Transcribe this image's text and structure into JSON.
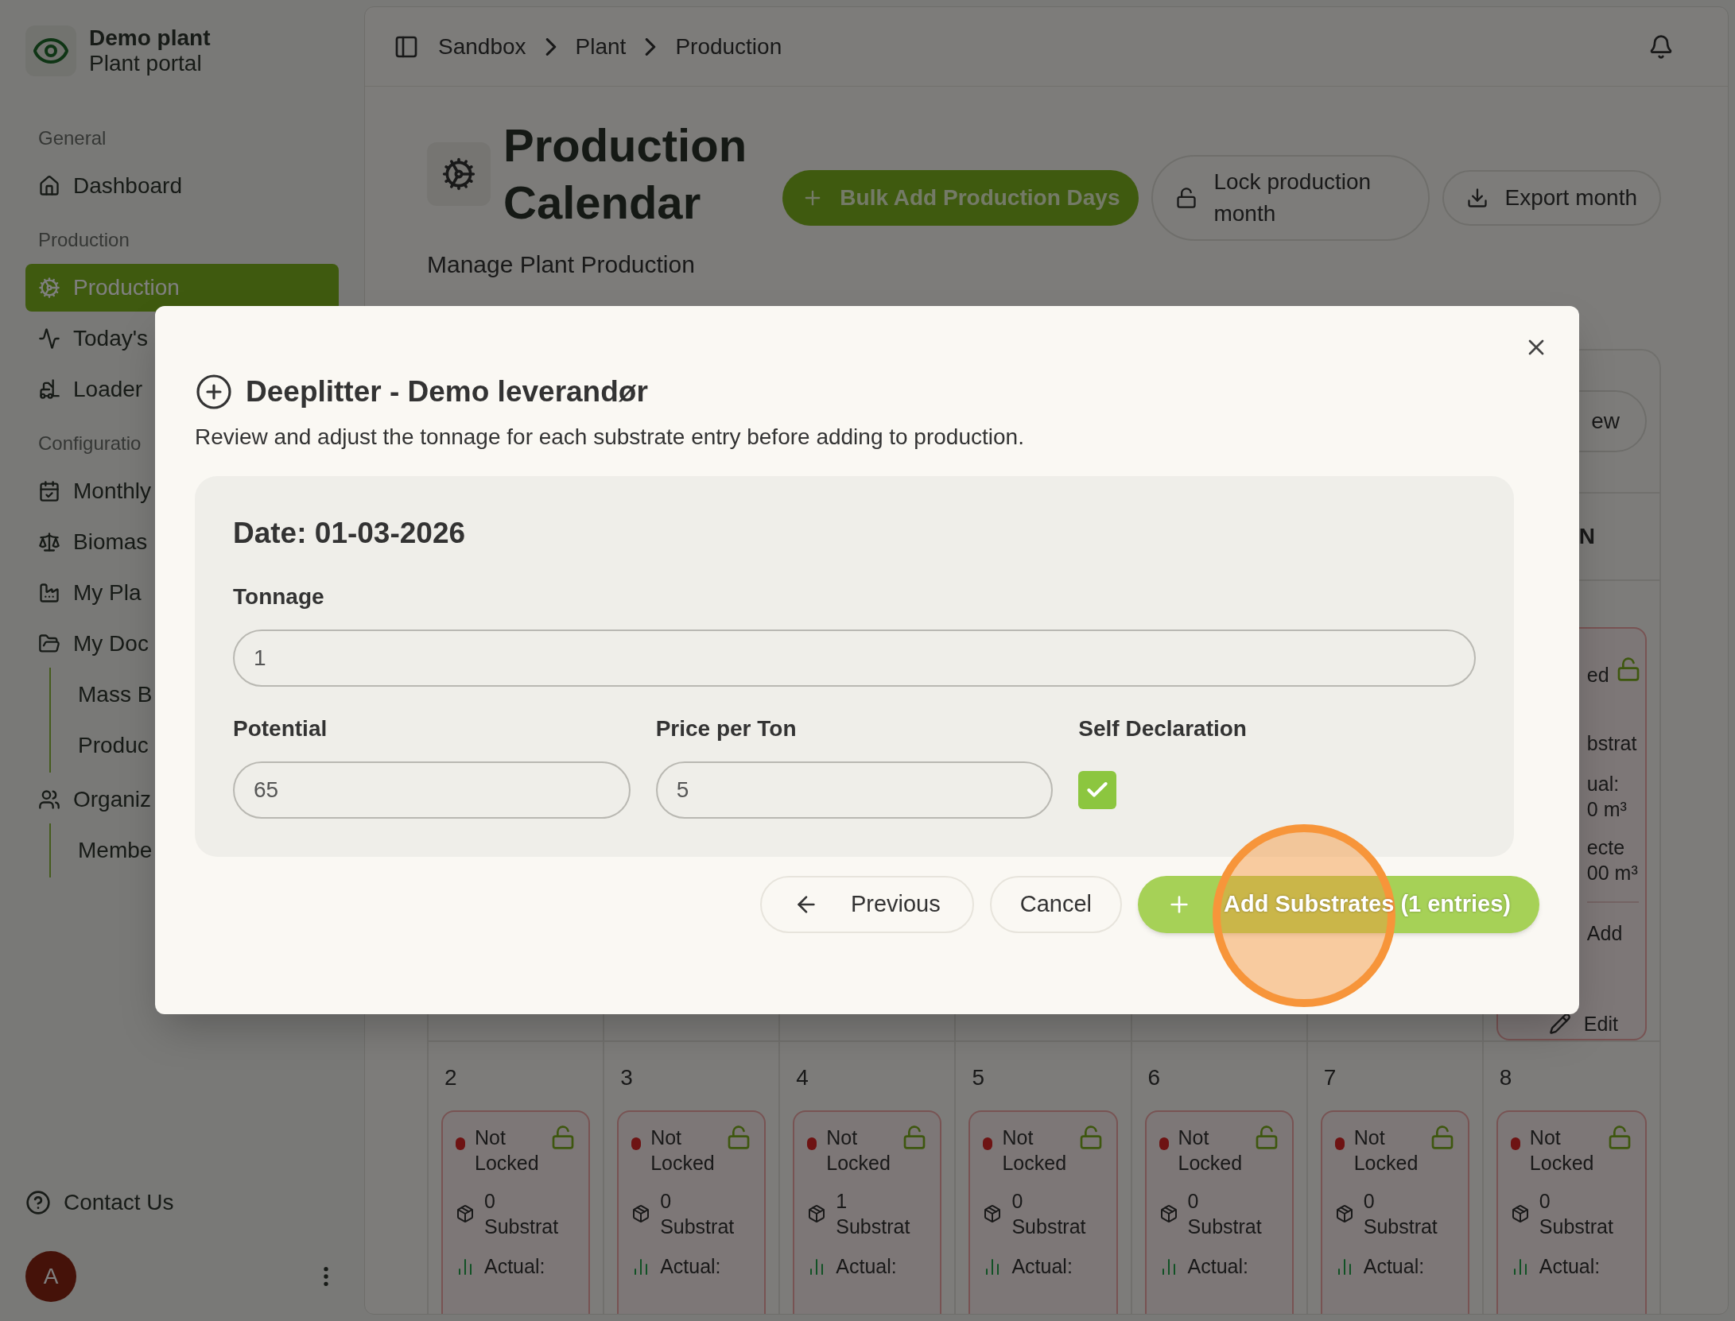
{
  "sidebar": {
    "brand": {
      "name": "Demo plant",
      "subtitle": "Plant portal"
    },
    "sections": [
      {
        "title": "General",
        "items": [
          {
            "label": "Dashboard",
            "selected": false
          }
        ]
      },
      {
        "title": "Production",
        "items": [
          {
            "label": "Production",
            "selected": true
          },
          {
            "label": "Today's",
            "selected": false
          },
          {
            "label": "Loader",
            "selected": false
          }
        ]
      },
      {
        "title": "Configuratio",
        "items": [
          {
            "label": "Monthly",
            "selected": false
          },
          {
            "label": "Biomas",
            "selected": false
          },
          {
            "label": "My Pla",
            "selected": false
          },
          {
            "label": "My Doc",
            "selected": false,
            "children": [
              {
                "label": "Mass B",
                "selected": false
              },
              {
                "label": "Produc",
                "selected": false
              }
            ]
          },
          {
            "label": "Organiz",
            "selected": false,
            "children": [
              {
                "label": "Membe",
                "selected": false
              }
            ]
          }
        ]
      }
    ],
    "contact": "Contact Us",
    "avatar": "A"
  },
  "header": {
    "breadcrumbs": [
      "Sandbox",
      "Plant",
      "Production"
    ]
  },
  "page": {
    "title": "Production Calendar",
    "subtitle": [
      "Manage Plant Production"
    ],
    "actions": [
      {
        "kind": "primary",
        "label": "Bulk Add Production Days"
      },
      {
        "kind": "outline",
        "label": "Lock production month"
      },
      {
        "kind": "outline",
        "label": "Export month"
      }
    ]
  },
  "calendar": {
    "view_button": "ew",
    "weekday": "N",
    "side_card": {
      "locked": false,
      "status": "ed",
      "substrates": "bstrat",
      "actual_label": "ual:",
      "actual_value": "0 m³",
      "expected_label": "ecte",
      "expected_value": "00 m³",
      "add": "Add",
      "edit": "Edit"
    },
    "days": [
      {
        "day": "2",
        "locked": false,
        "status": "Not Locked",
        "count": "0",
        "unit": "Substrat",
        "actual": "Actual:"
      },
      {
        "day": "3",
        "locked": false,
        "status": "Not Locked",
        "count": "0",
        "unit": "Substrat",
        "actual": "Actual:"
      },
      {
        "day": "4",
        "locked": false,
        "status": "Not Locked",
        "count": "1",
        "unit": "Substrat",
        "actual": "Actual:"
      },
      {
        "day": "5",
        "locked": false,
        "status": "Not Locked",
        "count": "0",
        "unit": "Substrat",
        "actual": "Actual:"
      },
      {
        "day": "6",
        "locked": false,
        "status": "Not Locked",
        "count": "0",
        "unit": "Substrat",
        "actual": "Actual:"
      },
      {
        "day": "7",
        "locked": false,
        "status": "Not Locked",
        "count": "0",
        "unit": "Substrat",
        "actual": "Actual:"
      },
      {
        "day": "8",
        "locked": false,
        "status": "Not Locked",
        "count": "0",
        "unit": "Substrat",
        "actual": "Actual:"
      }
    ]
  },
  "modal": {
    "title": "Deeplitter - Demo leverandør",
    "description": "Review and adjust the tonnage for each substrate entry before adding to production.",
    "entry": {
      "date": "Date: 01-03-2026",
      "tonnage": {
        "label": "Tonnage",
        "value": "1"
      },
      "potential": {
        "label": "Potential",
        "value": "65"
      },
      "price": {
        "label": "Price per Ton",
        "value": "5"
      },
      "self_declaration": {
        "label": "Self Declaration",
        "checked": true
      }
    },
    "buttons": {
      "previous": "Previous",
      "cancel": "Cancel",
      "add": "Add Substrates (1 entries)"
    }
  }
}
